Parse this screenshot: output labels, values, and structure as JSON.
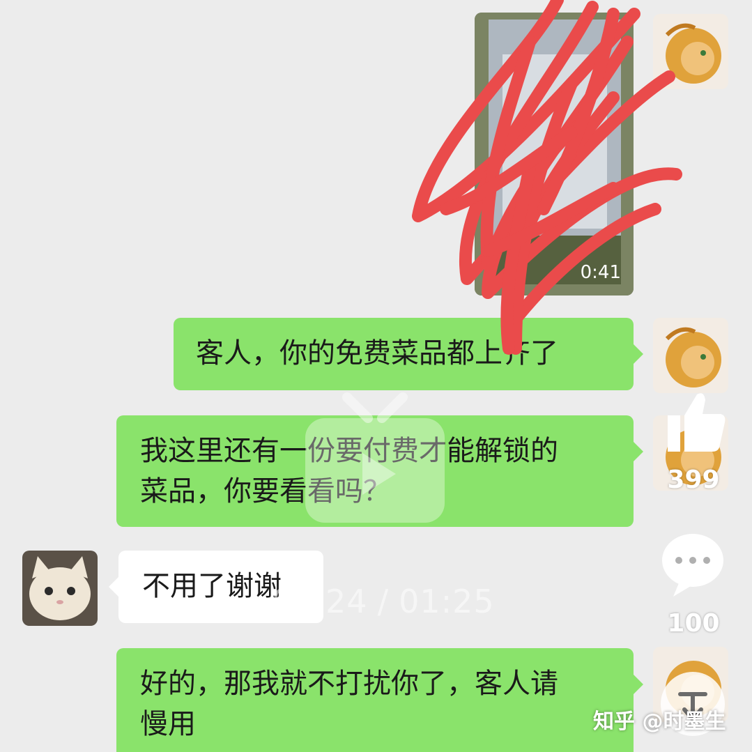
{
  "chat": {
    "video": {
      "duration": "0:41"
    },
    "messages": [
      {
        "side": "right",
        "lines": [
          "客人，你的免费菜品都上齐了"
        ]
      },
      {
        "side": "right",
        "lines": [
          "我这里还有一份要付费才能解锁的",
          "菜品，你要看看吗？"
        ]
      },
      {
        "side": "left",
        "lines": [
          "不用了谢谢"
        ]
      },
      {
        "side": "right",
        "lines": [
          "好的，那我就不打扰你了，客人请",
          "慢用"
        ]
      }
    ]
  },
  "player": {
    "current_time": "00:24",
    "separator": "/",
    "total_time": "01:25"
  },
  "actions": {
    "like_count": "399",
    "comment_count": "100"
  },
  "watermark": {
    "text": "知乎 @时墨生"
  },
  "colors": {
    "background": "#ececec",
    "bubble_green": "#8ae36b",
    "bubble_white": "#ffffff",
    "scribble": "#ea4b4b"
  },
  "icons": [
    "like-icon",
    "comment-icon",
    "collapse-icon",
    "bilibili-logo-watermark"
  ]
}
